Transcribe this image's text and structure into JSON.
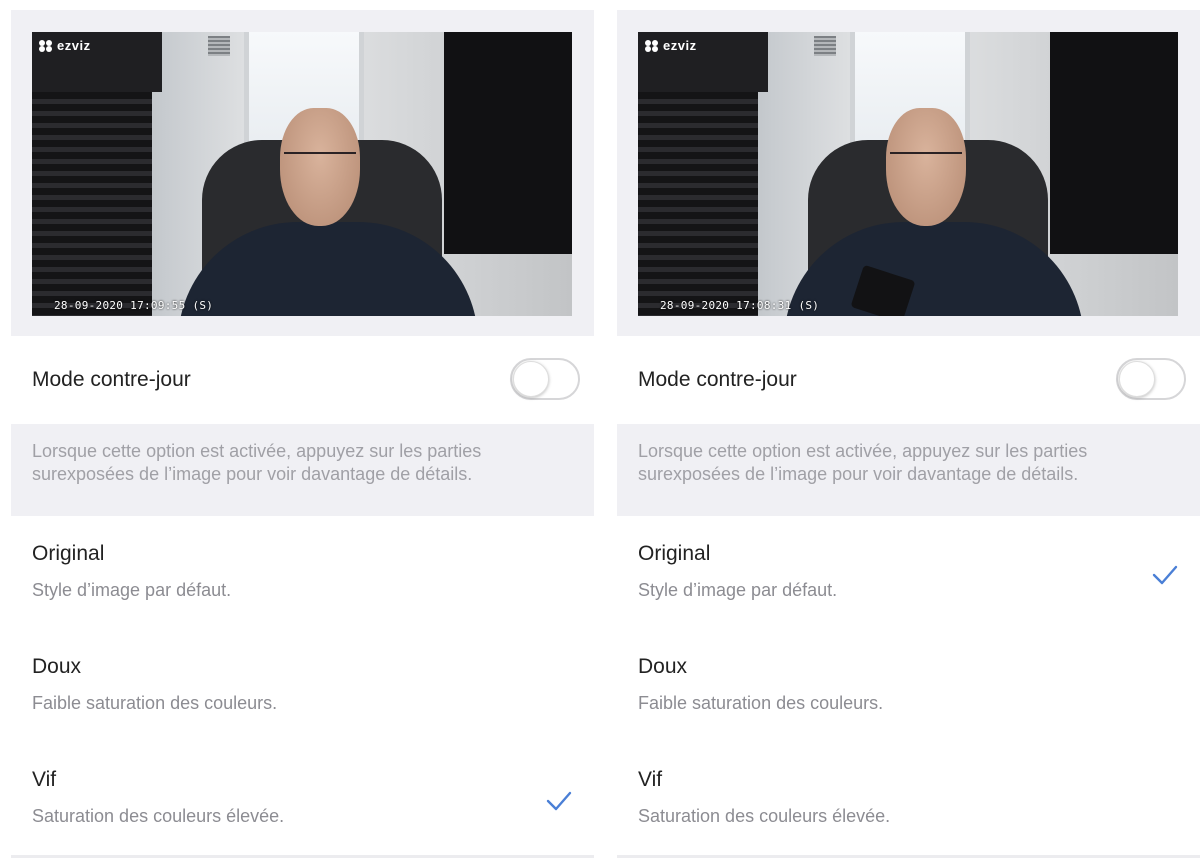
{
  "colors": {
    "accent": "#4a7fd6",
    "panel_bg": "#f0f0f4",
    "hint_text": "#a0a0a6"
  },
  "panels": [
    {
      "camera": {
        "brand": "ezviz",
        "timestamp": "28-09-2020 17:09:55 (S)"
      },
      "backlight": {
        "label": "Mode contre-jour",
        "enabled": false
      },
      "hint": "Lorsque cette option est activée, appuyez sur les parties surexposées de l’image pour voir davantage de détails.",
      "options": [
        {
          "title": "Original",
          "desc": "Style d’image par défaut.",
          "selected": false
        },
        {
          "title": "Doux",
          "desc": "Faible saturation des couleurs.",
          "selected": false
        },
        {
          "title": "Vif",
          "desc": "Saturation des couleurs élevée.",
          "selected": true
        }
      ]
    },
    {
      "camera": {
        "brand": "ezviz",
        "timestamp": "28-09-2020 17:08:31 (S)"
      },
      "backlight": {
        "label": "Mode contre-jour",
        "enabled": false
      },
      "hint": "Lorsque cette option est activée, appuyez sur les parties surexposées de l’image pour voir davantage de détails.",
      "options": [
        {
          "title": "Original",
          "desc": "Style d’image par défaut.",
          "selected": true
        },
        {
          "title": "Doux",
          "desc": "Faible saturation des couleurs.",
          "selected": false
        },
        {
          "title": "Vif",
          "desc": "Saturation des couleurs élevée.",
          "selected": false
        }
      ]
    }
  ]
}
